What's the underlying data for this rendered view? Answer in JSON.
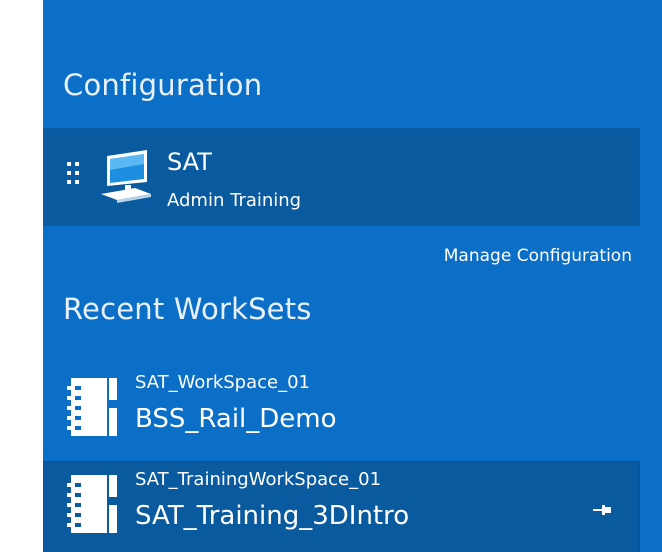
{
  "configuration": {
    "heading": "Configuration",
    "current": {
      "name": "SAT",
      "subtitle": "Admin Training",
      "icon": "computer-icon"
    },
    "manage_link": "Manage Configuration"
  },
  "recent_worksets": {
    "heading": "Recent WorkSets",
    "items": [
      {
        "workspace": "SAT_WorkSpace_01",
        "workset": "BSS_Rail_Demo",
        "icon": "workset-book-icon",
        "highlighted": false
      },
      {
        "workspace": "SAT_TrainingWorkSpace_01",
        "workset": "SAT_Training_3DIntro",
        "icon": "workset-book-icon",
        "highlighted": true,
        "pin_icon": "pin-icon"
      }
    ]
  },
  "colors": {
    "panel_background": "#0b6ec7",
    "card_background": "#0a5a9f",
    "text": "#ffffff"
  }
}
